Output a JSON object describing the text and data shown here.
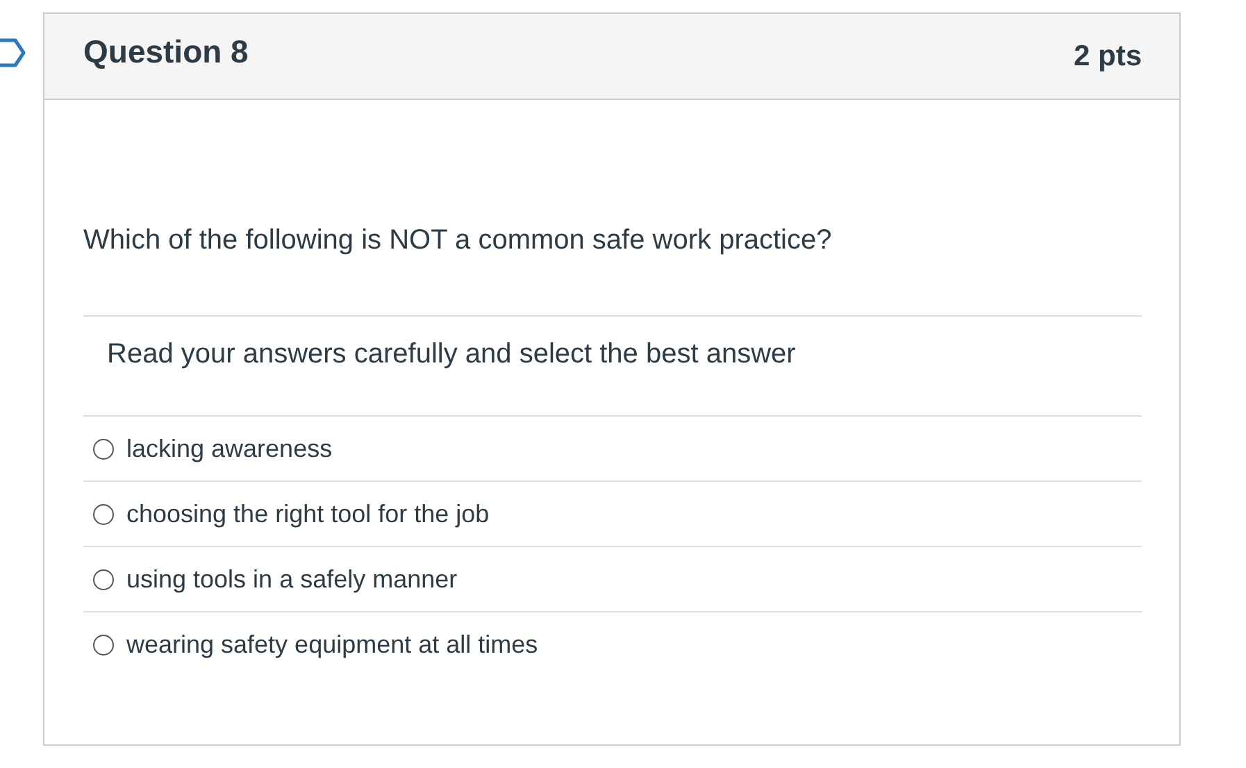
{
  "question": {
    "title": "Question 8",
    "points": "2 pts",
    "text": "Which of the following is NOT a common safe work practice?",
    "instruction": "Read your answers carefully and select the best answer",
    "answers": [
      {
        "label": "lacking awareness",
        "selected": false
      },
      {
        "label": "choosing the right tool for the job",
        "selected": false
      },
      {
        "label": "using tools in a safely manner",
        "selected": false
      },
      {
        "label": "wearing safety equipment at all times",
        "selected": false
      }
    ]
  }
}
